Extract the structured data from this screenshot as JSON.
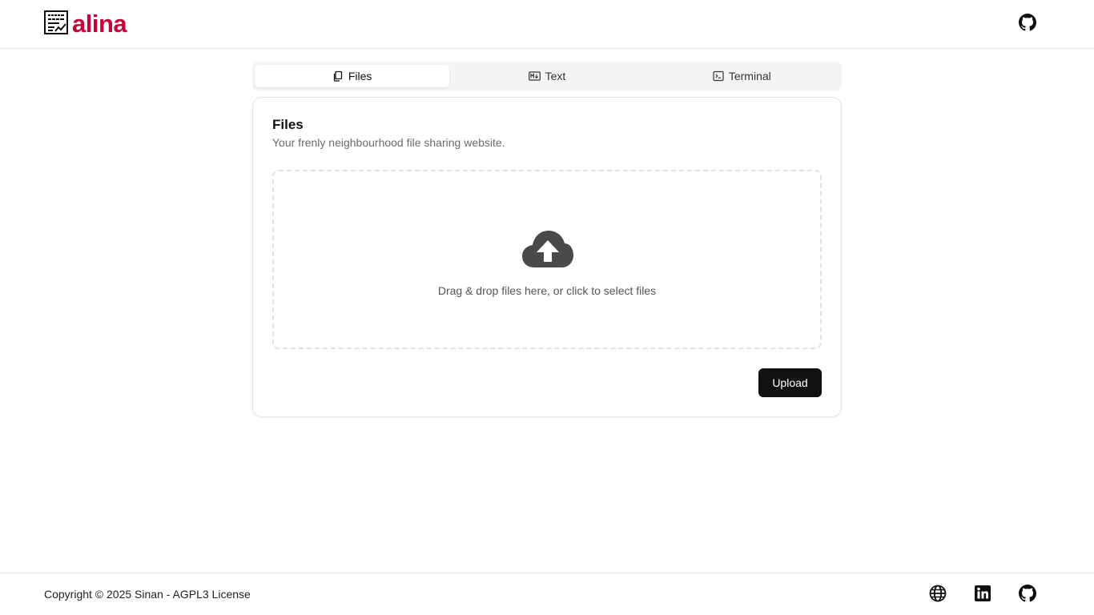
{
  "header": {
    "brand_text": "alina",
    "brand_color": "#c4003a",
    "logo_icon": "document-chart-icon",
    "github_icon": "github-icon"
  },
  "tabs": [
    {
      "label": "Files",
      "icon": "files-icon",
      "active": true
    },
    {
      "label": "Text",
      "icon": "markdown-icon",
      "active": false
    },
    {
      "label": "Terminal",
      "icon": "terminal-icon",
      "active": false
    }
  ],
  "card": {
    "title": "Files",
    "description": "Your frenly neighbourhood file sharing website.",
    "dropzone_icon": "cloud-upload-icon",
    "dropzone_text": "Drag & drop files here, or click to select files",
    "upload_label": "Upload"
  },
  "footer": {
    "copyright": "Copyright © 2025 Sinan - AGPL3 License",
    "icons": [
      "globe-icon",
      "linkedin-icon",
      "github-icon"
    ]
  }
}
